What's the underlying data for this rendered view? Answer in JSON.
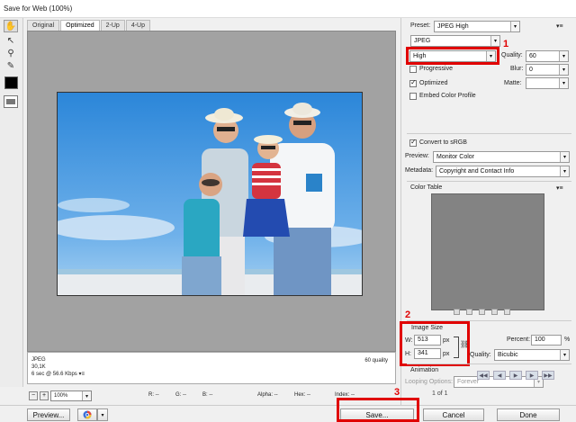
{
  "window": {
    "title": "Save for Web (100%)"
  },
  "tabs": [
    "Original",
    "Optimized",
    "2-Up",
    "4-Up"
  ],
  "tools": [
    "hand-icon",
    "slice-select-icon",
    "zoom-icon",
    "eyedropper-icon"
  ],
  "image_info": {
    "format": "JPEG",
    "size": "30,1K",
    "time": "6 sec @ 56.6 Kbps",
    "menu_glyph": "▾≡",
    "quality_text": "60 quality"
  },
  "status": {
    "zoom": "100%",
    "minus": "−",
    "plus": "+",
    "r": "R: --",
    "g": "G: --",
    "b": "B: --",
    "alpha": "Alpha: --",
    "hex": "Hex: --",
    "index": "Index: --"
  },
  "buttons": {
    "preview": "Preview...",
    "save": "Save...",
    "cancel": "Cancel",
    "done": "Done"
  },
  "settings": {
    "preset_label": "Preset:",
    "preset_value": "JPEG High",
    "format_value": "JPEG",
    "quality_level": "High",
    "quality_label": "Quality:",
    "quality_value": "60",
    "progressive_label": "Progressive",
    "blur_label": "Blur:",
    "blur_value": "0",
    "optimized_label": "Optimized",
    "matte_label": "Matte:",
    "embed_label": "Embed Color Profile",
    "convert_label": "Convert to sRGB",
    "preview_label": "Preview:",
    "preview_value": "Monitor Color",
    "metadata_label": "Metadata:",
    "metadata_value": "Copyright and Contact Info",
    "color_table_label": "Color Table",
    "image_size_label": "Image Size",
    "w_label": "W:",
    "w_value": "513",
    "h_label": "H:",
    "h_value": "341",
    "px": "px",
    "percent_label": "Percent:",
    "percent_value": "100",
    "percent_sign": "%",
    "resample_label": "Quality:",
    "resample_value": "Bicubic",
    "animation_label": "Animation",
    "looping_label": "Looping Options:",
    "looping_value": "Forever",
    "frame_counter": "1 of 1"
  },
  "annotations": {
    "step1": "1",
    "step2": "2",
    "step3": "3"
  },
  "colors": {
    "highlight": "#e00000",
    "canvas": "#a2a2a2",
    "color_table": "#838383"
  }
}
